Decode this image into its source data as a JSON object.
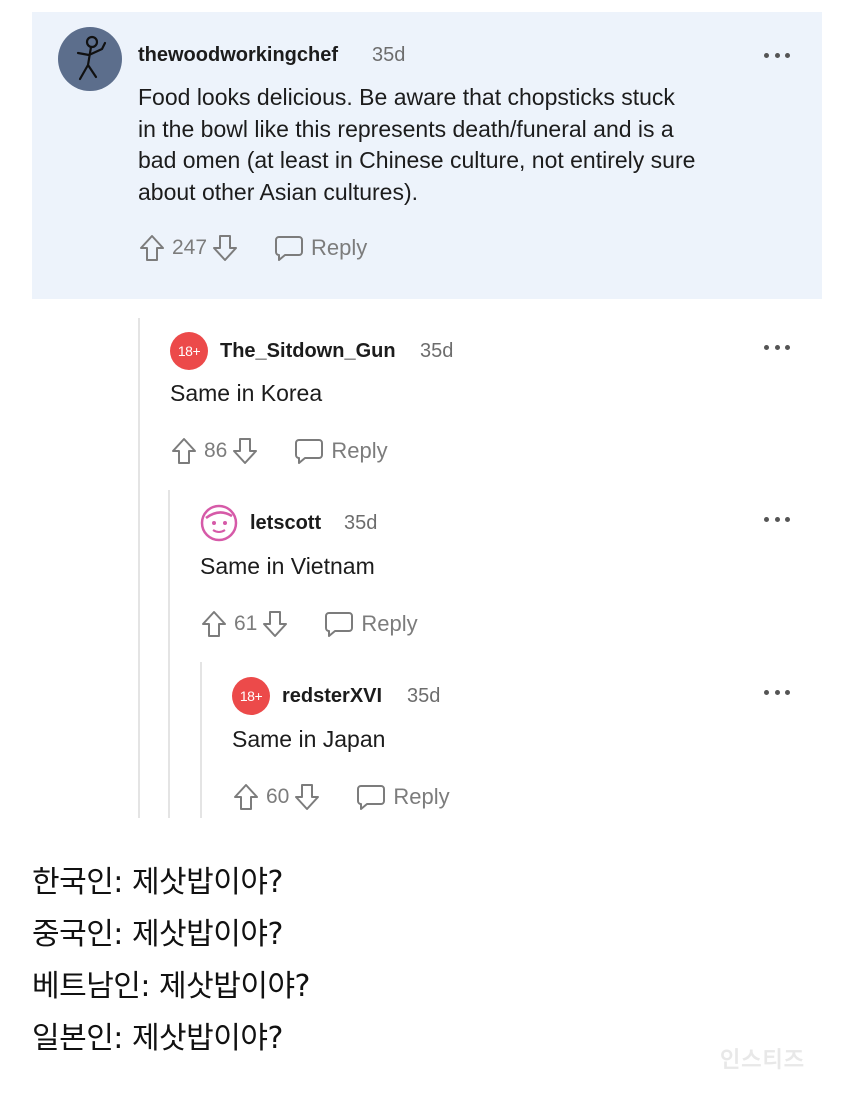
{
  "comments": [
    {
      "username": "thewoodworkingchef",
      "age": "35d",
      "body_lines": [
        "Food looks delicious. Be aware that chopsticks stuck",
        "in the bowl like this represents death/funeral and is a",
        "bad omen (at least in Chinese culture, not entirely sure",
        "about other Asian cultures)."
      ],
      "score": "247",
      "reply_label": "Reply",
      "avatar": "stick-figure-avatar"
    },
    {
      "username": "The_Sitdown_Gun",
      "age": "35d",
      "body": "Same in Korea",
      "score": "86",
      "reply_label": "Reply",
      "avatar_text": "18+"
    },
    {
      "username": "letscott",
      "age": "35d",
      "body": "Same in Vietnam",
      "score": "61",
      "reply_label": "Reply",
      "avatar": "face-avatar"
    },
    {
      "username": "redsterXVI",
      "age": "35d",
      "body": "Same in Japan",
      "score": "60",
      "reply_label": "Reply",
      "avatar_text": "18+"
    }
  ],
  "captions": [
    "한국인: 제삿밥이야?",
    "중국인:  제삿밥이야?",
    "베트남인: 제삿밥이야?",
    "일본인: 제삿밥이야?"
  ],
  "watermark": "인스티즈",
  "colors": {
    "highlight_bg": "#edf3fb",
    "nsfw_avatar": "#ec4a4a",
    "meta_gray": "#7c7c7c"
  }
}
